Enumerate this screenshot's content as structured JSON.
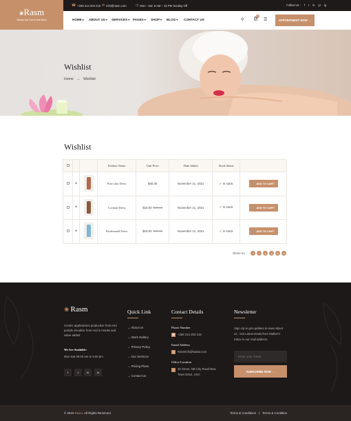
{
  "brand": {
    "name": "Rasm",
    "tagline": "Beauty Spa Care & Nail Salon",
    "accent": "#c6906b",
    "dark": "#1e1a19"
  },
  "topbar": {
    "phone": "+256 214 203 215",
    "email": "info@rasm.com",
    "hours": "Mon - Sat: 8 AM – 15 PM Sunday Off",
    "follow_label": "Follow Us :",
    "social": [
      "f",
      "t",
      "in",
      "yt",
      "ig"
    ]
  },
  "nav": {
    "items": [
      "HOME",
      "ABOUT US",
      "SERVICES",
      "PAGES",
      "SHOP",
      "BLOG",
      "CONTACT US"
    ],
    "cart_count": "0",
    "appointment": "APPOINTMENT NOW →"
  },
  "hero": {
    "title": "Wishlist",
    "crumb_home": "Home",
    "crumb_sep": "→",
    "crumb_current": "Wishlist"
  },
  "wishlist": {
    "title": "Wishlist",
    "headers": [
      "",
      "",
      "",
      "Product Name",
      "Unit Price",
      "Date Added",
      "Stock Status",
      ""
    ],
    "rows": [
      {
        "name": "Pure skin Dress",
        "price": "$45.00",
        "old": "",
        "date": "November 21, 2021",
        "stock": "✓ In stock",
        "btn": "🛒 ADD TO CART",
        "bottle": "#b36a4d"
      },
      {
        "name": "Cocktail Dress",
        "price": "$18.00",
        "old": "$20.00",
        "date": "November 21, 2021",
        "stock": "✓ In stock",
        "btn": "🛒 ADD TO CART",
        "bottle": "#8a5a3a"
      },
      {
        "name": "Bridesmaid Dress",
        "price": "$18.00",
        "old": "$30.00",
        "date": "November 21, 2021",
        "stock": "✓ In stock",
        "btn": "🛒 ADD TO CART",
        "bottle": "#7fb6d6"
      }
    ],
    "share_label": "Share on :",
    "share": [
      "f",
      "t",
      "p",
      "g",
      "in",
      "m"
    ]
  },
  "footer": {
    "about": "Centric applications productize front end portals visualize front end is results and value added",
    "available_title": "We Are Available:",
    "available": "Mon-Sat 08.00 am to 5.00 pm",
    "social": [
      "f",
      "t",
      "in",
      "in"
    ],
    "quick_title": "Quick Link",
    "quick": [
      "→ About Us",
      "→ Work Gallery",
      "→ Privacy Policy",
      "→ Our Services",
      "→ Pricing Plans",
      "→ Contact Us"
    ],
    "contact_title": "Contact Details",
    "phone_label": "Phone Number",
    "phone": "+256 214 203 215",
    "email_label": "Email Address",
    "email": "Rasminfo@taalar.com",
    "office_label": "Office Location",
    "office_l1": "25 Street, NB City Road New",
    "office_l2": "Town D014, USA",
    "news_title": "Newsletter",
    "news_text_1": "Sign Up to get updates & news about",
    "news_text_2": "us . Get Latest Deals from Walker's",
    "news_text_3": "Inbox to our mail address.",
    "email_placeholder": "Enter your email",
    "subscribe": "SUBSCRIBE NOW →",
    "copy_prefix": "© 2023 ",
    "copy_brand": "Rasm",
    "copy_suffix": ". All Rights Reserved.",
    "terms1": "Terms & Conditions",
    "terms_sep": "|",
    "terms2": "Terms & Condition"
  }
}
